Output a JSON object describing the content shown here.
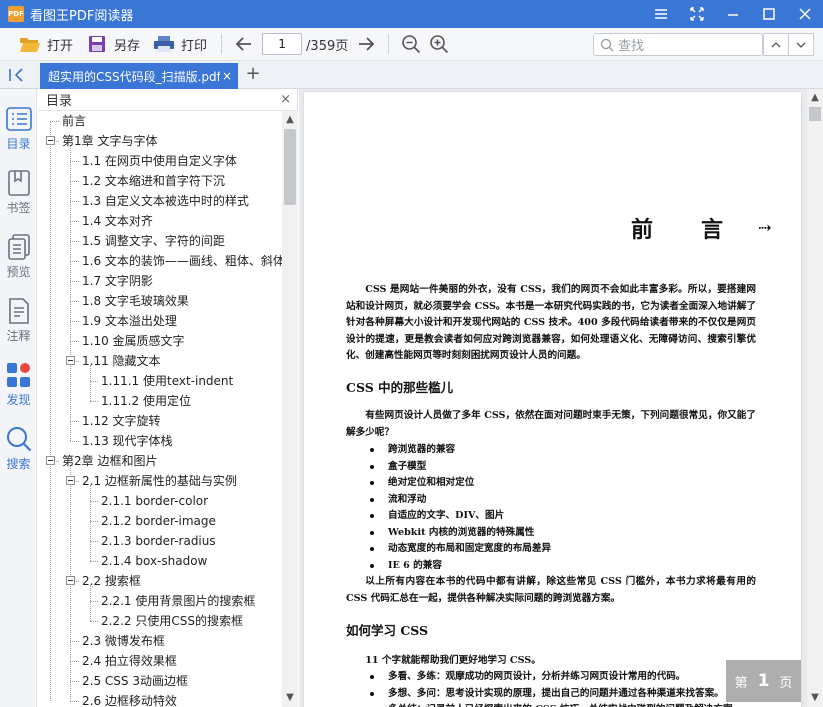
{
  "window": {
    "app_logo": "PDF",
    "app_title": "看图王PDF阅读器",
    "controls": [
      "menu-icon",
      "fullscreen-icon",
      "minimize-icon",
      "maximize-icon",
      "close-icon"
    ]
  },
  "toolbar": {
    "open_label": "打开",
    "save_as_label": "另存",
    "print_label": "打印",
    "current_page": "1",
    "total_pages": "/359页",
    "search_placeholder": "查找"
  },
  "tabs": {
    "active_tab": "超实用的CSS代码段_扫描版.pdf",
    "close_symbol": "×",
    "add_symbol": "+"
  },
  "rail": {
    "items": [
      {
        "label": "目录",
        "icon": "toc-icon"
      },
      {
        "label": "书签",
        "icon": "bookmark-icon"
      },
      {
        "label": "预览",
        "icon": "thumbnails-icon"
      },
      {
        "label": "注释",
        "icon": "annotation-icon"
      },
      {
        "label": "发现",
        "icon": "discover-icon"
      },
      {
        "label": "搜索",
        "icon": "search-icon"
      }
    ]
  },
  "toc": {
    "title": "目录",
    "close_symbol": "×",
    "items": [
      {
        "label": "前言",
        "level": 0,
        "toggle": false
      },
      {
        "label": "第1章 文字与字体",
        "level": 0,
        "toggle": true
      },
      {
        "label": "1.1 在网页中使用自定义字体",
        "level": 1,
        "toggle": false
      },
      {
        "label": "1.2 文本缩进和首字符下沉",
        "level": 1,
        "toggle": false
      },
      {
        "label": "1.3 自定义文本被选中时的样式",
        "level": 1,
        "toggle": false
      },
      {
        "label": "1.4 文本对齐",
        "level": 1,
        "toggle": false
      },
      {
        "label": "1.5 调整文字、字符的间距",
        "level": 1,
        "toggle": false
      },
      {
        "label": "1.6 文本的装饰——画线、粗体、斜体",
        "level": 1,
        "toggle": false
      },
      {
        "label": "1.7 文字阴影",
        "level": 1,
        "toggle": false
      },
      {
        "label": "1.8 文字毛玻璃效果",
        "level": 1,
        "toggle": false
      },
      {
        "label": "1.9 文本溢出处理",
        "level": 1,
        "toggle": false
      },
      {
        "label": "1.10 金属质感文字",
        "level": 1,
        "toggle": false
      },
      {
        "label": "1.11 隐藏文本",
        "level": 1,
        "toggle": true
      },
      {
        "label": "1.11.1 使用text-indent",
        "level": 2,
        "toggle": false
      },
      {
        "label": "1.11.2 使用定位",
        "level": 2,
        "toggle": false
      },
      {
        "label": "1.12 文字旋转",
        "level": 1,
        "toggle": false
      },
      {
        "label": "1.13 现代字体栈",
        "level": 1,
        "toggle": false
      },
      {
        "label": "第2章 边框和图片",
        "level": 0,
        "toggle": true
      },
      {
        "label": "2.1 边框新属性的基础与实例",
        "level": 1,
        "toggle": true
      },
      {
        "label": "2.1.1 border-color",
        "level": 2,
        "toggle": false
      },
      {
        "label": "2.1.2 border-image",
        "level": 2,
        "toggle": false
      },
      {
        "label": "2.1.3 border-radius",
        "level": 2,
        "toggle": false
      },
      {
        "label": "2.1.4 box-shadow",
        "level": 2,
        "toggle": false
      },
      {
        "label": "2.2 搜索框",
        "level": 1,
        "toggle": true
      },
      {
        "label": "2.2.1 使用背景图片的搜索框",
        "level": 2,
        "toggle": false
      },
      {
        "label": "2.2.2 只使用CSS的搜索框",
        "level": 2,
        "toggle": false
      },
      {
        "label": "2.3 微博发布框",
        "level": 1,
        "toggle": false
      },
      {
        "label": "2.4 拍立得效果框",
        "level": 1,
        "toggle": false
      },
      {
        "label": "2.5 CSS 3动画边框",
        "level": 1,
        "toggle": false
      },
      {
        "label": "2.6 边框移动特效",
        "level": 1,
        "toggle": false
      }
    ]
  },
  "document": {
    "title": "前言",
    "title_arrow": "⇢",
    "para1": "CSS 是网站一件美丽的外衣，没有 CSS，我们的网页不会如此丰富多彩。所以，要搭建网站和设计网页，就必须要学会 CSS。本书是一本研究代码实践的书，它为读者全面深入地讲解了针对各种屏幕大小设计和开发现代网站的 CSS 技术。400 多段代码给读者带来的不仅仅是网页设计的提速，更是教会读者如何应对跨浏览器兼容，如何处理语义化、无障碍访问、搜索引擎优化、创建高性能网页等时刻刻困扰网页设计人员的问题。",
    "heading1": "CSS 中的那些槛儿",
    "para2": "有些网页设计人员做了多年 CSS，依然在面对问题时束手无策，下列问题很常见，你又能了解多少呢？",
    "bullets1": [
      "跨浏览器的兼容",
      "盒子模型",
      "绝对定位和相对定位",
      "流和浮动",
      "自适应的文字、DIV、图片",
      "Webkit 内核的浏览器的特殊属性",
      "动态宽度的布局和固定宽度的布局差异",
      "IE 6 的兼容"
    ],
    "para3": "以上所有内容在本书的代码中都有讲解，除这些常见 CSS 门槛外，本书力求将最有用的 CSS 代码汇总在一起，提供各种解决实际问题的跨浏览器方案。",
    "heading2": "如何学习 CSS",
    "para4": "11 个字就能帮助我们更好地学习 CSS。",
    "bullets2": [
      "多看、多练：观摩成功的网页设计，分析并练习网页设计常用的代码。",
      "多想、多问：思考设计实现的原理，提出自己的问题并通过各种渠道来找答案。",
      "多总结：记录前人已经探索出来的 CSS 技巧，总结实战中碰到的问题及解决方案。"
    ]
  },
  "page_badge": {
    "prefix": "第",
    "number": "1",
    "suffix": "页"
  },
  "colors": {
    "accent": "#3a76d6",
    "icon_gray": "#6b7280",
    "discover_red": "#e8493f"
  }
}
